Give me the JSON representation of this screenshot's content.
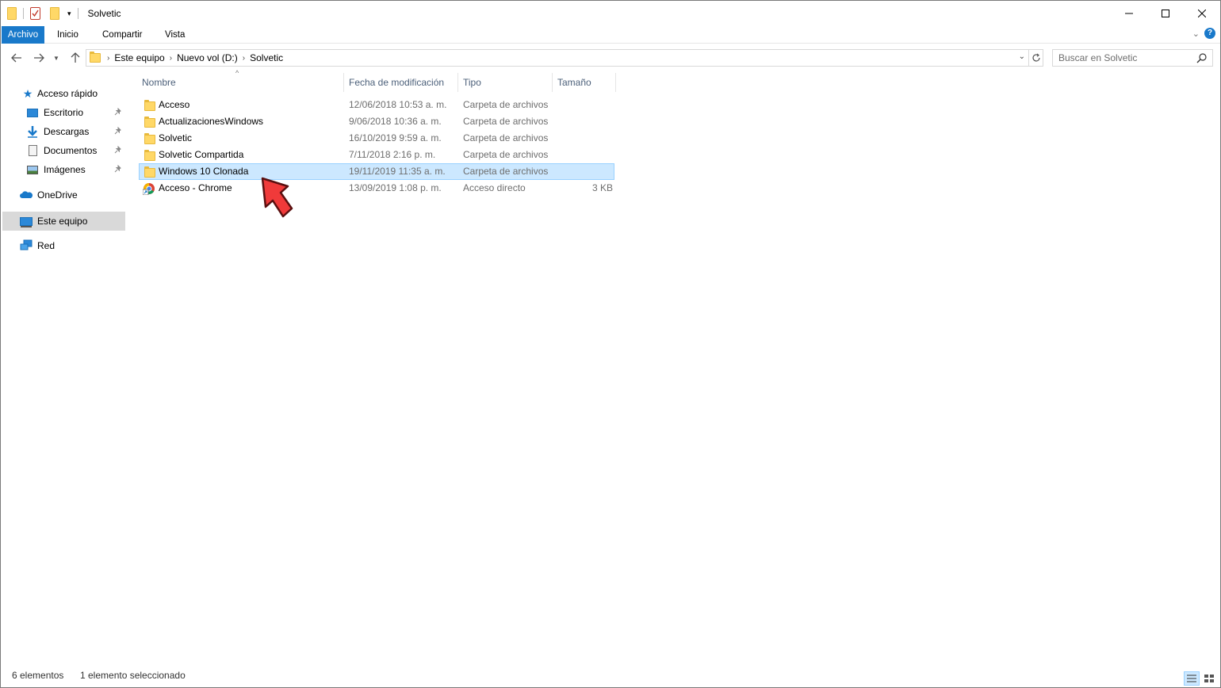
{
  "window": {
    "title": "Solvetic"
  },
  "ribbon": {
    "tabs": [
      {
        "label": "Archivo",
        "active": true
      },
      {
        "label": "Inicio"
      },
      {
        "label": "Compartir"
      },
      {
        "label": "Vista"
      }
    ]
  },
  "address": {
    "breadcrumbs": [
      "Este equipo",
      "Nuevo vol (D:)",
      "Solvetic"
    ]
  },
  "search": {
    "placeholder": "Buscar en Solvetic"
  },
  "navpane": {
    "items": [
      {
        "label": "Acceso rápido",
        "icon": "star-icon"
      },
      {
        "label": "Escritorio",
        "icon": "desktop-icon",
        "pinned": true
      },
      {
        "label": "Descargas",
        "icon": "download-icon",
        "pinned": true
      },
      {
        "label": "Documentos",
        "icon": "document-icon",
        "pinned": true
      },
      {
        "label": "Imágenes",
        "icon": "pictures-icon",
        "pinned": true
      },
      {
        "label": "OneDrive",
        "icon": "cloud-icon"
      },
      {
        "label": "Este equipo",
        "icon": "computer-icon",
        "selected": true
      },
      {
        "label": "Red",
        "icon": "network-icon"
      }
    ]
  },
  "table": {
    "columns": [
      "Nombre",
      "Fecha de modificación",
      "Tipo",
      "Tamaño"
    ],
    "rows": [
      {
        "name": "Acceso",
        "date": "12/06/2018 10:53 a. m.",
        "type": "Carpeta de archivos",
        "size": "",
        "icon": "folder-icon"
      },
      {
        "name": "ActualizacionesWindows",
        "date": "9/06/2018 10:36 a. m.",
        "type": "Carpeta de archivos",
        "size": "",
        "icon": "folder-icon"
      },
      {
        "name": "Solvetic",
        "date": "16/10/2019 9:59 a. m.",
        "type": "Carpeta de archivos",
        "size": "",
        "icon": "folder-icon"
      },
      {
        "name": "Solvetic Compartida",
        "date": "7/11/2018 2:16 p. m.",
        "type": "Carpeta de archivos",
        "size": "",
        "icon": "folder-icon"
      },
      {
        "name": "Windows 10 Clonada",
        "date": "19/11/2019 11:35 a. m.",
        "type": "Carpeta de archivos",
        "size": "",
        "icon": "folder-icon",
        "selected": true
      },
      {
        "name": "Acceso - Chrome",
        "date": "13/09/2019 1:08 p. m.",
        "type": "Acceso directo",
        "size": "3 KB",
        "icon": "chrome-shortcut-icon"
      }
    ]
  },
  "status": {
    "count": "6 elementos",
    "selection": "1 elemento seleccionado"
  },
  "colors": {
    "accent": "#1979ca",
    "selection_bg": "#cce8ff",
    "selection_border": "#99d1ff",
    "annotation_arrow": "#f03a3a"
  }
}
